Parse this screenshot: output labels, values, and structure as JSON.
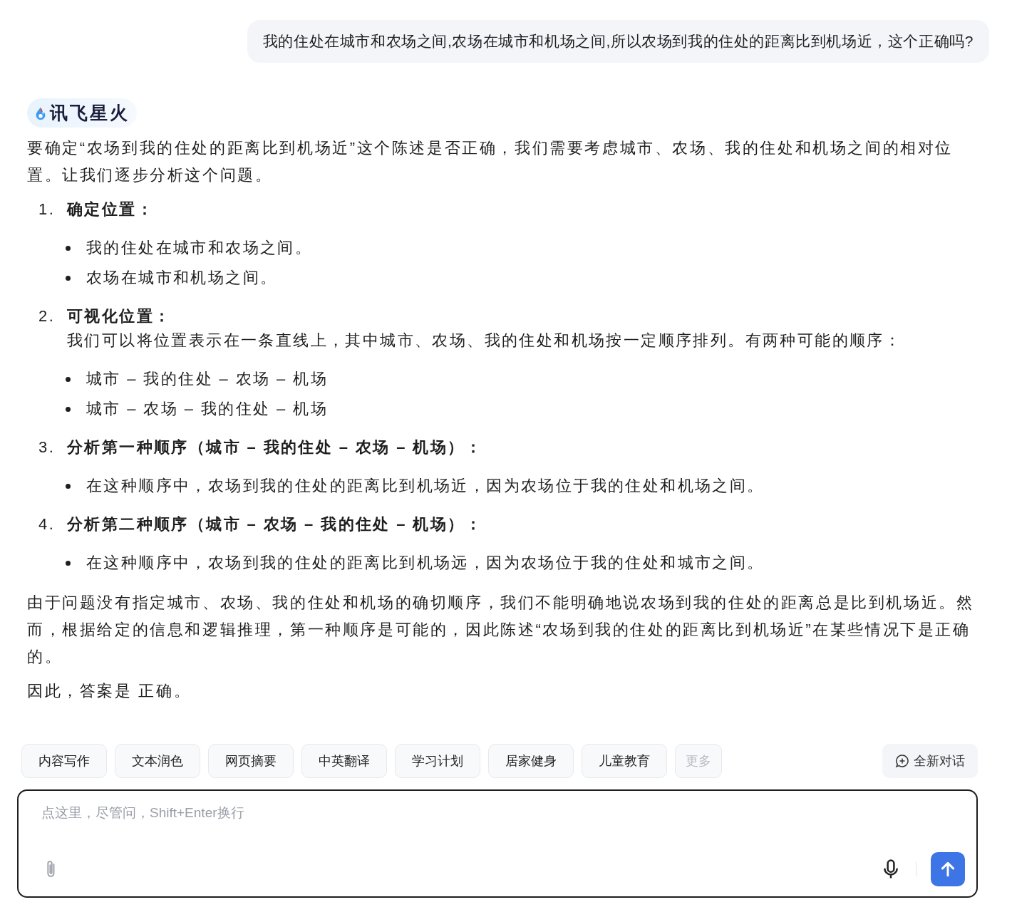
{
  "user_message": {
    "text": "我的住处在城市和农场之间,农场在城市和机场之间,所以农场到我的住处的距离比到机场近，这个正确吗?"
  },
  "assistant": {
    "brand": "讯飞星火",
    "intro": "要确定“农场到我的住处的距离比到机场近”这个陈述是否正确，我们需要考虑城市、农场、我的住处和机场之间的相对位置。让我们逐步分析这个问题。",
    "steps": [
      {
        "number": "1.",
        "title": "确定位置：",
        "bullets": [
          "我的住处在城市和农场之间。",
          "农场在城市和机场之间。"
        ]
      },
      {
        "number": "2.",
        "title": "可视化位置：",
        "description": "我们可以将位置表示在一条直线上，其中城市、农场、我的住处和机场按一定顺序排列。有两种可能的顺序：",
        "bullets": [
          "城市 – 我的住处 – 农场 – 机场",
          "城市 – 农场 – 我的住处 – 机场"
        ]
      },
      {
        "number": "3.",
        "title": "分析第一种顺序（城市 – 我的住处 – 农场 – 机场）：",
        "bullets": [
          "在这种顺序中，农场到我的住处的距离比到机场近，因为农场位于我的住处和机场之间。"
        ]
      },
      {
        "number": "4.",
        "title": "分析第二种顺序（城市 – 农场 – 我的住处 – 机场）：",
        "bullets": [
          "在这种顺序中，农场到我的住处的距离比到机场远，因为农场位于我的住处和城市之间。"
        ]
      }
    ],
    "conclusion": "由于问题没有指定城市、农场、我的住处和机场的确切顺序，我们不能明确地说农场到我的住处的距离总是比到机场近。然而，根据给定的信息和逻辑推理，第一种顺序是可能的，因此陈述“农场到我的住处的距离比到机场近”在某些情况下是正确的。",
    "answer": "因此，答案是 正确。"
  },
  "chips": [
    {
      "label": "内容写作",
      "disabled": false
    },
    {
      "label": "文本润色",
      "disabled": false
    },
    {
      "label": "网页摘要",
      "disabled": false
    },
    {
      "label": "中英翻译",
      "disabled": false
    },
    {
      "label": "学习计划",
      "disabled": false
    },
    {
      "label": "居家健身",
      "disabled": false
    },
    {
      "label": "儿童教育",
      "disabled": false
    },
    {
      "label": "更多",
      "disabled": true
    }
  ],
  "new_chat_button": {
    "label": "全新对话"
  },
  "input": {
    "placeholder": "点这里，尽管问，Shift+Enter换行"
  }
}
